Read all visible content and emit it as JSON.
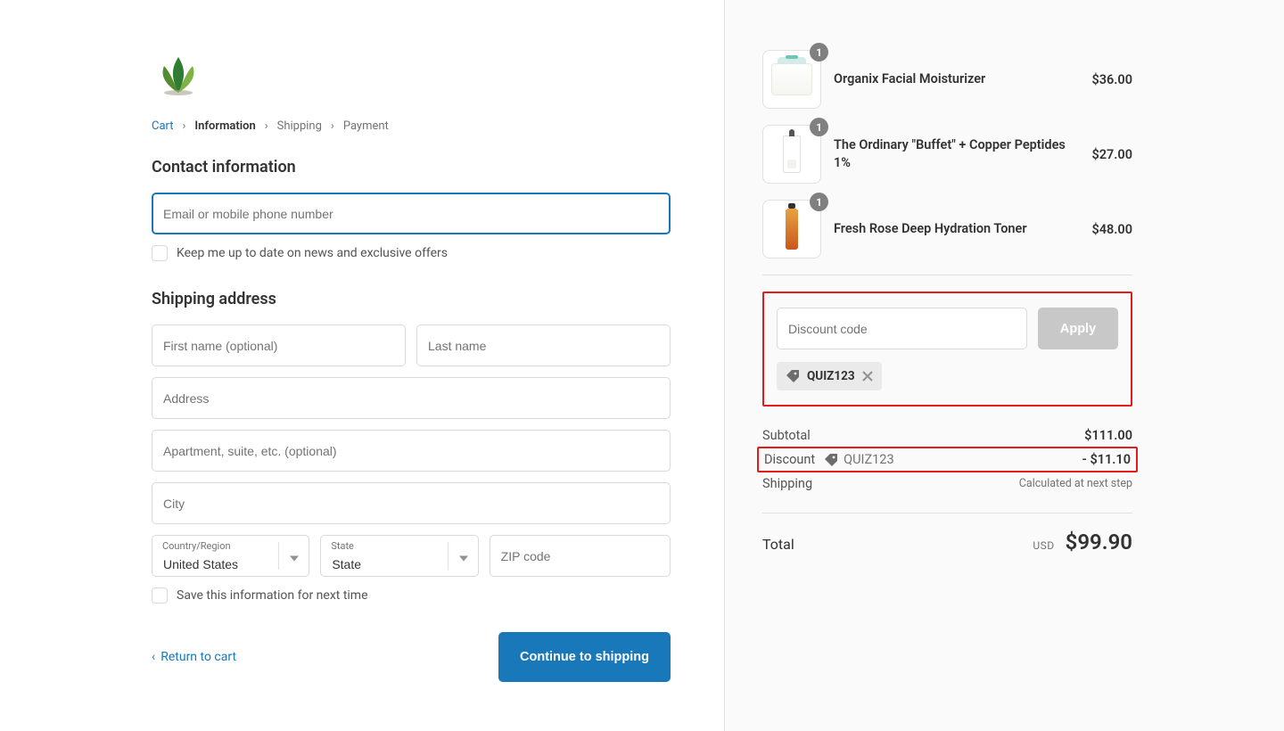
{
  "breadcrumb": {
    "cart": "Cart",
    "information": "Information",
    "shipping": "Shipping",
    "payment": "Payment"
  },
  "contact": {
    "heading": "Contact information",
    "email_placeholder": "Email or mobile phone number",
    "news_label": "Keep me up to date on news and exclusive offers"
  },
  "shipping": {
    "heading": "Shipping address",
    "first_name_placeholder": "First name (optional)",
    "last_name_placeholder": "Last name",
    "address_placeholder": "Address",
    "apt_placeholder": "Apartment, suite, etc. (optional)",
    "city_placeholder": "City",
    "country_label": "Country/Region",
    "country_value": "United States",
    "state_label": "State",
    "state_value": "State",
    "zip_placeholder": "ZIP code",
    "save_label": "Save this information for next time"
  },
  "footer": {
    "return": "Return to cart",
    "continue": "Continue to shipping"
  },
  "cart": {
    "items": [
      {
        "name": "Organix Facial Moisturizer",
        "price": "$36.00",
        "qty": "1"
      },
      {
        "name": "The Ordinary \"Buffet\" + Copper Peptides 1%",
        "price": "$27.00",
        "qty": "1"
      },
      {
        "name": "Fresh Rose Deep Hydration Toner",
        "price": "$48.00",
        "qty": "1"
      }
    ]
  },
  "discount": {
    "placeholder": "Discount code",
    "apply": "Apply",
    "applied_code": "QUIZ123"
  },
  "summary": {
    "subtotal_label": "Subtotal",
    "subtotal_value": "$111.00",
    "discount_label": "Discount",
    "discount_code": "QUIZ123",
    "discount_value": "- $11.10",
    "shipping_label": "Shipping",
    "shipping_note": "Calculated at next step",
    "total_label": "Total",
    "currency": "USD",
    "total_value": "$99.90"
  }
}
